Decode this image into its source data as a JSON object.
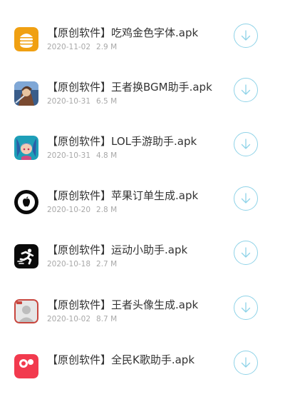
{
  "apps": [
    {
      "title": "【原创软件】吃鸡金色字体.apk",
      "date": "2020-11-02",
      "size": "2.9 M",
      "icon": "chicken-burger-icon"
    },
    {
      "title": "【原创软件】王者换BGM助手.apk",
      "date": "2020-10-31",
      "size": "6.5 M",
      "icon": "game-hero-icon"
    },
    {
      "title": "【原创软件】LOL手游助手.apk",
      "date": "2020-10-31",
      "size": "4.8 M",
      "icon": "lol-champion-icon"
    },
    {
      "title": "【原创软件】苹果订单生成.apk",
      "date": "2020-10-20",
      "size": "2.8 M",
      "icon": "apple-icon"
    },
    {
      "title": "【原创软件】运动小助手.apk",
      "date": "2020-10-18",
      "size": "2.7 M",
      "icon": "runner-icon"
    },
    {
      "title": "【原创软件】王者头像生成.apk",
      "date": "2020-10-02",
      "size": "8.7 M",
      "icon": "avatar-icon"
    },
    {
      "title": "【原创软件】全民K歌助手.apk",
      "date": "",
      "size": "",
      "icon": "karaoke-icon"
    }
  ],
  "colors": {
    "title": "#333333",
    "meta": "#a8a8a8",
    "download_accent": "#8fd3e8"
  },
  "download_icon": "download-arrow-icon"
}
